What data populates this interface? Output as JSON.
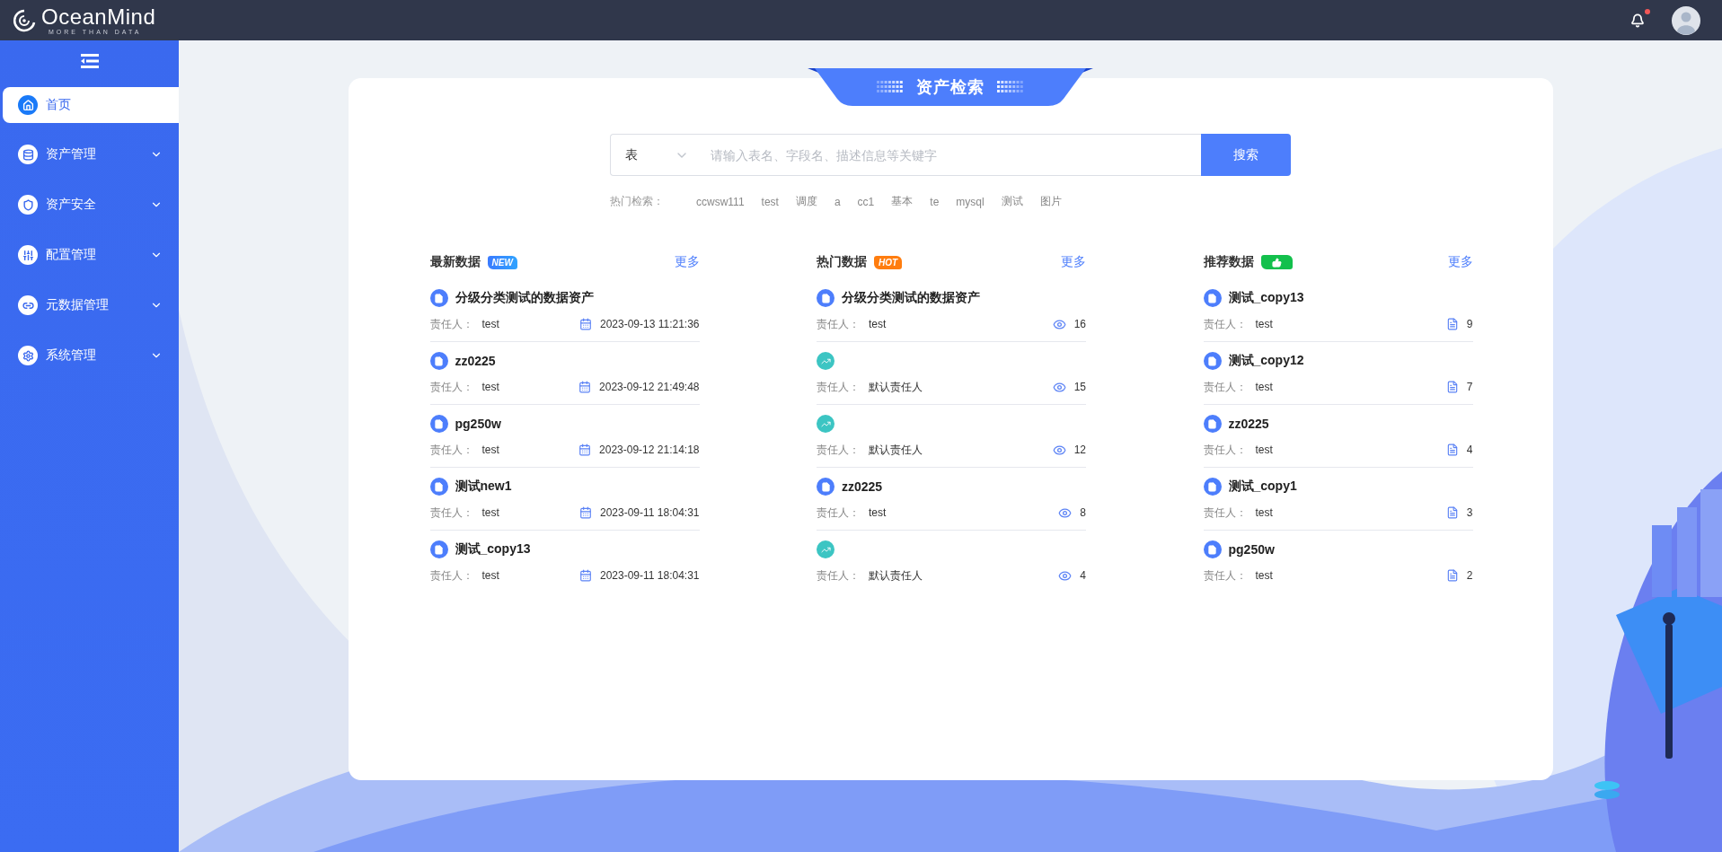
{
  "header": {
    "logo": {
      "name": "OceanMind",
      "tagline": "MORE THAN DATA"
    },
    "notifications": {
      "unread": true
    }
  },
  "sidebar": {
    "items": [
      {
        "label": "首页",
        "selected": true,
        "submenu": false
      },
      {
        "label": "资产管理",
        "selected": false,
        "submenu": true
      },
      {
        "label": "资产安全",
        "selected": false,
        "submenu": true
      },
      {
        "label": "配置管理",
        "selected": false,
        "submenu": true
      },
      {
        "label": "元数据管理",
        "selected": false,
        "submenu": true
      },
      {
        "label": "系统管理",
        "selected": false,
        "submenu": true
      }
    ]
  },
  "search": {
    "title": "资产检索",
    "type": "表",
    "placeholder": "请输入表名、字段名、描述信息等关键字",
    "button": "搜索",
    "hot_label": "热门检索：",
    "hot_terms": [
      "ccwsw111",
      "test",
      "调度",
      "a",
      "cc1",
      "基本",
      "te",
      "mysql",
      "测试",
      "图片"
    ]
  },
  "columns": [
    {
      "title": "最新数据",
      "kind": "new",
      "badge": "NEW",
      "more": "更多",
      "items": [
        {
          "kind": "table",
          "name": "分级分类测试的数据资产",
          "owner_label": "责任人：",
          "owner": "test",
          "value": "2023-09-13 11:21:36"
        },
        {
          "kind": "table",
          "name": "zz0225",
          "owner_label": "责任人：",
          "owner": "test",
          "value": "2023-09-12 21:49:48"
        },
        {
          "kind": "table",
          "name": "pg250w",
          "owner_label": "责任人：",
          "owner": "test",
          "value": "2023-09-12 21:14:18"
        },
        {
          "kind": "table",
          "name": "测试new1",
          "owner_label": "责任人：",
          "owner": "test",
          "value": "2023-09-11 18:04:31"
        },
        {
          "kind": "table",
          "name": "测试_copy13",
          "owner_label": "责任人：",
          "owner": "test",
          "value": "2023-09-11 18:04:31"
        }
      ]
    },
    {
      "title": "热门数据",
      "kind": "hot",
      "badge": "HOT",
      "more": "更多",
      "items": [
        {
          "kind": "table",
          "name": "分级分类测试的数据资产",
          "owner_label": "责任人：",
          "owner": "test",
          "value": "16"
        },
        {
          "kind": "chart",
          "owner_label": "责任人：",
          "owner": "默认责任人",
          "value": "15"
        },
        {
          "kind": "chart",
          "owner_label": "责任人：",
          "owner": "默认责任人",
          "value": "12"
        },
        {
          "kind": "table",
          "name": "zz0225",
          "owner_label": "责任人：",
          "owner": "test",
          "value": "8"
        },
        {
          "kind": "chart",
          "owner_label": "责任人：",
          "owner": "默认责任人",
          "value": "4"
        }
      ]
    },
    {
      "title": "推荐数据",
      "kind": "recommend",
      "more": "更多",
      "items": [
        {
          "kind": "table",
          "name": "测试_copy13",
          "owner_label": "责任人：",
          "owner": "test",
          "value": "9"
        },
        {
          "kind": "table",
          "name": "测试_copy12",
          "owner_label": "责任人：",
          "owner": "test",
          "value": "7"
        },
        {
          "kind": "table",
          "name": "zz0225",
          "owner_label": "责任人：",
          "owner": "test",
          "value": "4"
        },
        {
          "kind": "table",
          "name": "测试_copy1",
          "owner_label": "责任人：",
          "owner": "test",
          "value": "3"
        },
        {
          "kind": "table",
          "name": "pg250w",
          "owner_label": "责任人：",
          "owner": "test",
          "value": "2"
        }
      ]
    }
  ]
}
